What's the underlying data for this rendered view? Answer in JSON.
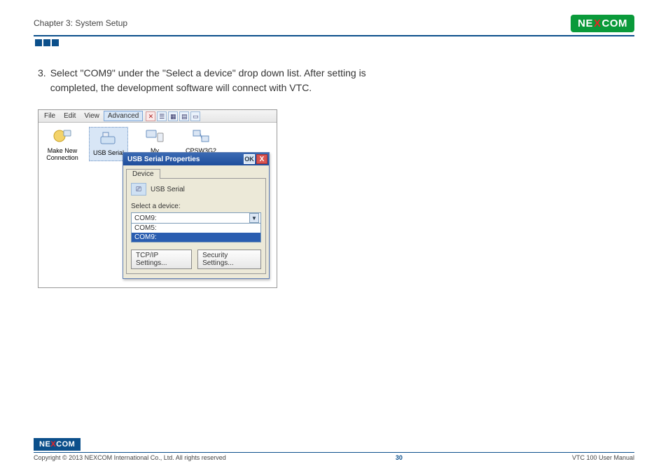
{
  "header": {
    "chapter": "Chapter 3: System Setup",
    "logo_text_1": "NE",
    "logo_text_x": "X",
    "logo_text_2": "COM"
  },
  "instruction": {
    "number": "3.",
    "text": "Select \"COM9\" under the \"Select a device\" drop down list. After setting is completed, the development software will connect with VTC."
  },
  "screenshot": {
    "menubar": {
      "file": "File",
      "edit": "Edit",
      "view": "View",
      "advanced": "Advanced"
    },
    "desktop_icons": {
      "make_new_connection": "Make New Connection",
      "usb_serial": "USB Serial",
      "my_connection": "My Connection",
      "cpsw3g2": "CPSW3G2"
    },
    "dialog": {
      "title": "USB Serial Properties",
      "ok": "OK",
      "close": "X",
      "tab_device": "Device",
      "device_name": "USB Serial",
      "select_label": "Select a device:",
      "combo_value": "COM9:",
      "options": {
        "com5": "COM5:",
        "com9": "COM9:"
      },
      "tcpip_btn": "TCP/IP Settings...",
      "security_btn": "Security Settings..."
    }
  },
  "footer": {
    "logo_text_1": "NE",
    "logo_text_x": "X",
    "logo_text_2": "COM",
    "copyright": "Copyright © 2013 NEXCOM International Co., Ltd. All rights reserved",
    "page_number": "30",
    "manual": "VTC 100 User Manual"
  }
}
